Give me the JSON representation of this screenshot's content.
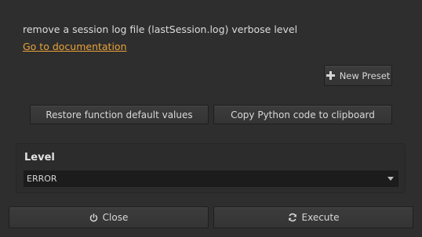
{
  "description": "remove a session log file (lastSession.log) verbose level",
  "doc_link": "Go to documentation",
  "presets": {
    "new_preset_label": "New Preset",
    "icon": "plus-icon"
  },
  "actions": {
    "restore_label": "Restore function default values",
    "copy_label": "Copy Python code to clipboard"
  },
  "level": {
    "label": "Level",
    "selected": "ERROR"
  },
  "footer": {
    "close_label": "Close",
    "close_icon": "power-icon",
    "execute_label": "Execute",
    "execute_icon": "refresh-icon"
  },
  "colors": {
    "background": "#2e2e2e",
    "link": "#e9a23b",
    "text": "#dcdcdc"
  }
}
